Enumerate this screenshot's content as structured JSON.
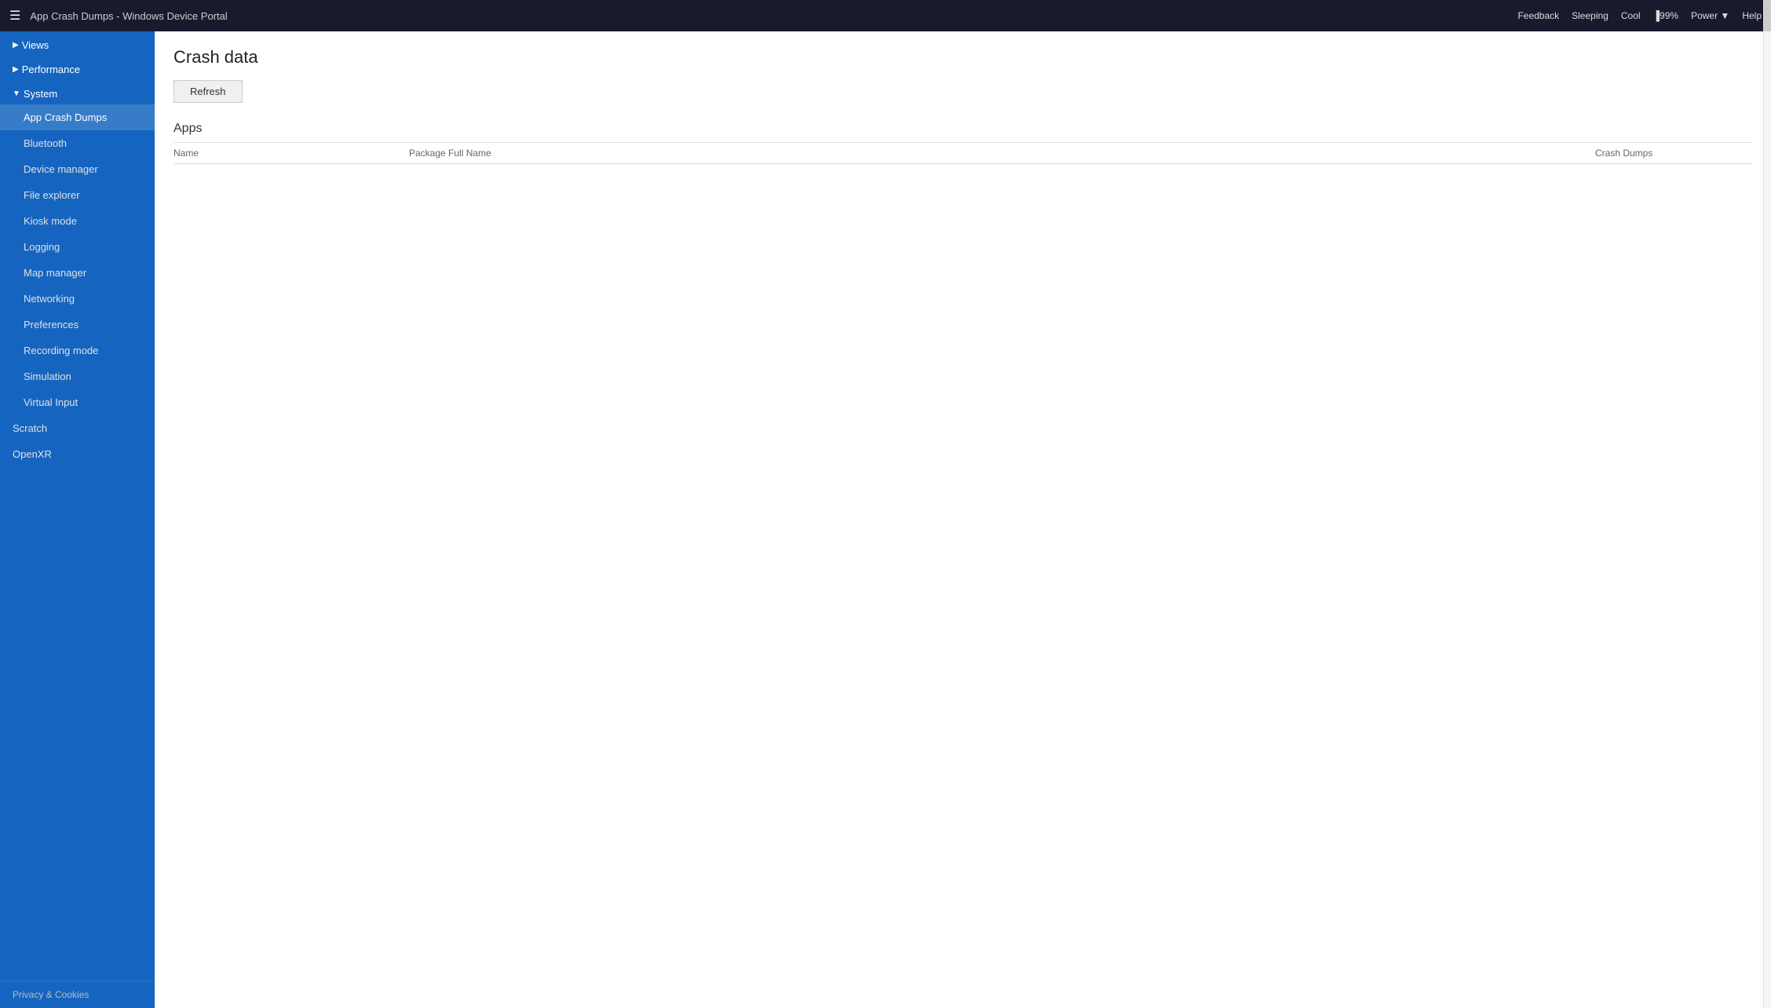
{
  "topbar": {
    "menu_icon": "☰",
    "title": "App Crash Dumps - Windows Device Portal",
    "status": {
      "feedback": "Feedback",
      "sleeping": "Sleeping",
      "cool": "Cool",
      "battery": "▐99%",
      "power": "Power ▼",
      "help": "Help"
    }
  },
  "sidebar": {
    "collapse_icon": "◄",
    "items": [
      {
        "id": "views",
        "label": "▶Views",
        "type": "section",
        "indent": false
      },
      {
        "id": "performance",
        "label": "▶Performance",
        "type": "section",
        "indent": false
      },
      {
        "id": "system",
        "label": "▼System",
        "type": "section",
        "indent": false
      },
      {
        "id": "app-crash-dumps",
        "label": "App Crash Dumps",
        "type": "item",
        "active": true
      },
      {
        "id": "bluetooth",
        "label": "Bluetooth",
        "type": "item",
        "active": false
      },
      {
        "id": "device-manager",
        "label": "Device manager",
        "type": "item",
        "active": false
      },
      {
        "id": "file-explorer",
        "label": "File explorer",
        "type": "item",
        "active": false
      },
      {
        "id": "kiosk-mode",
        "label": "Kiosk mode",
        "type": "item",
        "active": false
      },
      {
        "id": "logging",
        "label": "Logging",
        "type": "item",
        "active": false
      },
      {
        "id": "map-manager",
        "label": "Map manager",
        "type": "item",
        "active": false
      },
      {
        "id": "networking",
        "label": "Networking",
        "type": "item",
        "active": false
      },
      {
        "id": "preferences",
        "label": "Preferences",
        "type": "item",
        "active": false
      },
      {
        "id": "recording-mode",
        "label": "Recording mode",
        "type": "item",
        "active": false
      },
      {
        "id": "simulation",
        "label": "Simulation",
        "type": "item",
        "active": false
      },
      {
        "id": "virtual-input",
        "label": "Virtual Input",
        "type": "item",
        "active": false
      },
      {
        "id": "scratch",
        "label": "Scratch",
        "type": "top",
        "active": false
      },
      {
        "id": "openxr",
        "label": "OpenXR",
        "type": "top",
        "active": false
      }
    ],
    "footer": "Privacy & Cookies"
  },
  "content": {
    "page_title": "Crash data",
    "refresh_label": "Refresh",
    "section_title": "Apps",
    "table": {
      "columns": [
        {
          "id": "name",
          "label": "Name"
        },
        {
          "id": "package",
          "label": "Package Full Name"
        },
        {
          "id": "dumps",
          "label": "Crash Dumps"
        }
      ],
      "rows": []
    }
  }
}
